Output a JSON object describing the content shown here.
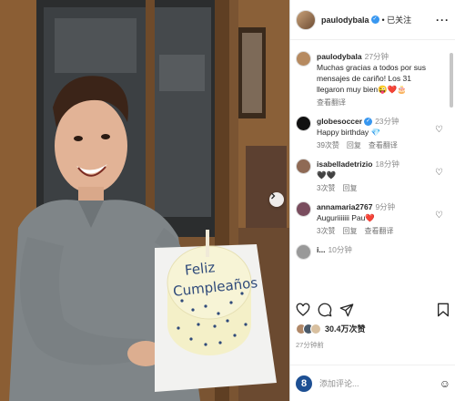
{
  "post": {
    "author": "paulodybala",
    "follow_state": "• 已关注",
    "more": "···",
    "cake_line1": "Feliz",
    "cake_line2": "Cumpleaños"
  },
  "comments": [
    {
      "user": "paulodybala",
      "time": "27分钟",
      "text": "Muchas gracias a todos por sus mensajes de cariño! Los 31 llegaron muy bien😜❤️🎂",
      "meta": [
        "查看翻译"
      ],
      "verified": false,
      "avatar_color": "#b68a60",
      "like": false
    },
    {
      "user": "globesoccer",
      "time": "23分钟",
      "text": "Happy birthday 💎",
      "meta": [
        "39次赞",
        "回复",
        "查看翻译"
      ],
      "verified": true,
      "avatar_color": "#111111",
      "like": true
    },
    {
      "user": "isabelladetrizio",
      "time": "18分钟",
      "text": "🖤🖤",
      "meta": [
        "3次赞",
        "回复"
      ],
      "verified": false,
      "avatar_color": "#8f6a55",
      "like": true
    },
    {
      "user": "annamaria2767",
      "time": "9分钟",
      "text": "Auguriiiiiii Pau❤️",
      "meta": [
        "3次赞",
        "回复",
        "查看翻译"
      ],
      "verified": false,
      "avatar_color": "#7a4d5e",
      "like": true
    },
    {
      "user": "i...",
      "time": "10分钟",
      "text": "",
      "meta": [],
      "verified": false,
      "avatar_color": "#999999",
      "like": false
    }
  ],
  "engagement": {
    "likes": "30.4万次赞",
    "time_ago": "27分钟前"
  },
  "add_comment": {
    "avatar_letter": "8",
    "placeholder": "添加评论..."
  },
  "colors": {
    "accent": "#3897f0",
    "text": "#262626",
    "muted": "#8e8e8e"
  }
}
